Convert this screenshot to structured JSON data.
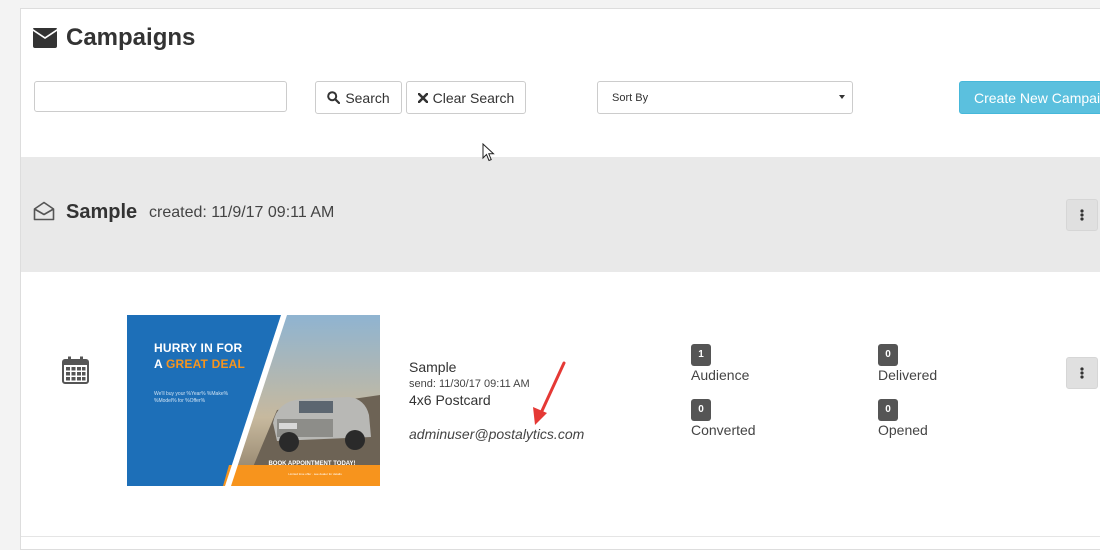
{
  "header": {
    "title": "Campaigns",
    "icon": "envelope-icon"
  },
  "toolbar": {
    "search_value": "",
    "search_label": "Search",
    "clear_label": "Clear Search",
    "sort_selected": "Sort By",
    "create_label": "Create New Campaign"
  },
  "group": {
    "name": "Sample",
    "created": "created: 11/9/17 09:11 AM"
  },
  "campaign": {
    "name": "Sample",
    "send": "send: 11/30/17 09:11 AM",
    "type": "4x6 Postcard",
    "owner": "adminuser@postalytics.com",
    "postcard": {
      "headline_1": "HURRY IN FOR",
      "headline_2a": "A ",
      "headline_2b": "GREAT DEAL",
      "body": "We'll buy your %Year% %Make% %Model% for %Offer%",
      "cta": "BOOK APPOINTMENT TODAY!",
      "fine_print": "Limited time offer · see dealer for details"
    },
    "stats": {
      "audience": {
        "value": "1",
        "label": "Audience"
      },
      "delivered": {
        "value": "0",
        "label": "Delivered"
      },
      "converted": {
        "value": "0",
        "label": "Converted"
      },
      "opened": {
        "value": "0",
        "label": "Opened"
      }
    }
  },
  "colors": {
    "accent": "#5bc0de",
    "badge": "#555555",
    "postcard_blue": "#1d6fb8",
    "postcard_orange": "#f7941d",
    "annotation_arrow": "#e53935"
  }
}
